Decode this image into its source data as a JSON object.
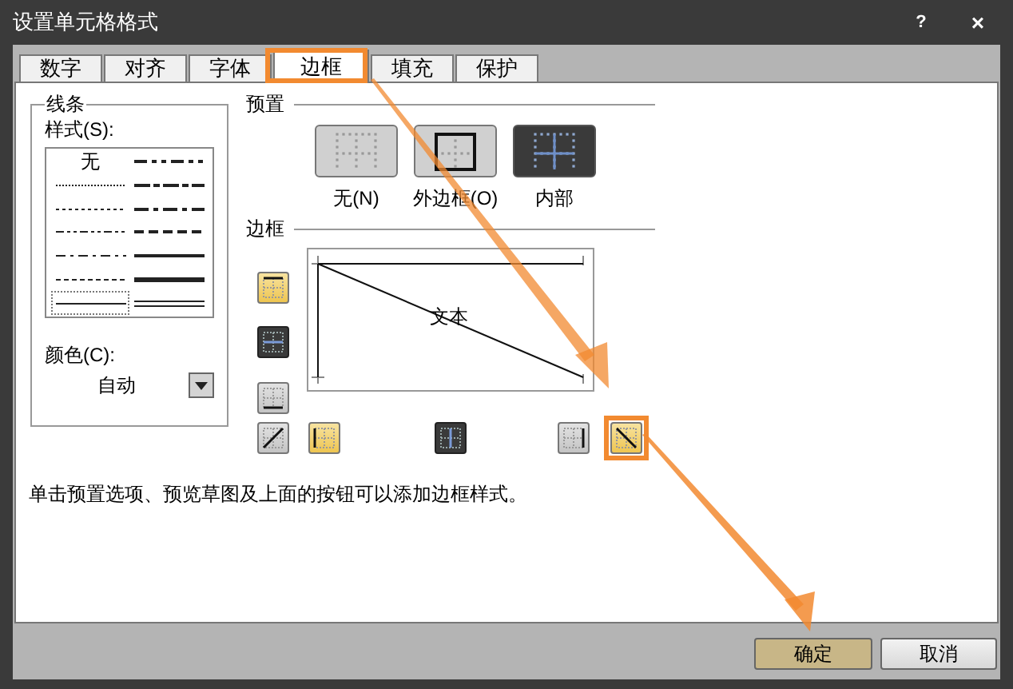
{
  "window": {
    "title": "设置单元格格式",
    "help": "?",
    "close": "×"
  },
  "tabs": [
    {
      "label": "数字",
      "selected": false
    },
    {
      "label": "对齐",
      "selected": false
    },
    {
      "label": "字体",
      "selected": false
    },
    {
      "label": "边框",
      "selected": true
    },
    {
      "label": "填充",
      "selected": false
    },
    {
      "label": "保护",
      "selected": false
    }
  ],
  "line": {
    "title": "线条",
    "style_label": "样式(S):",
    "styles": [
      {
        "kind": "none",
        "label": "无",
        "selected": false
      },
      {
        "kind": "medium-dash-dot-dot",
        "selected": false
      },
      {
        "kind": "hair",
        "selected": false
      },
      {
        "kind": "slanted-dash-dot",
        "selected": false
      },
      {
        "kind": "dotted",
        "selected": false
      },
      {
        "kind": "medium-dash-dot",
        "selected": false
      },
      {
        "kind": "dash-dot-dot",
        "selected": false
      },
      {
        "kind": "medium-dashed",
        "selected": false
      },
      {
        "kind": "dash-dot",
        "selected": false
      },
      {
        "kind": "medium",
        "selected": false
      },
      {
        "kind": "dashed",
        "selected": false
      },
      {
        "kind": "thick",
        "selected": false
      },
      {
        "kind": "thin",
        "selected": true
      },
      {
        "kind": "double",
        "selected": false
      }
    ],
    "color_label": "颜色(C):",
    "color_value": "自动"
  },
  "presets": {
    "title": "预置",
    "items": [
      {
        "kind": "none",
        "label": "无(N)",
        "selected": false
      },
      {
        "kind": "outline",
        "label": "外边框(O)",
        "selected": false
      },
      {
        "kind": "inside",
        "label": "内部",
        "selected": true
      }
    ]
  },
  "border": {
    "title": "边框",
    "preview_text": "文本",
    "side_buttons": [
      {
        "kind": "top",
        "highlighted": true,
        "pressed": false
      },
      {
        "kind": "inside-horizontal",
        "highlighted": false,
        "pressed": true
      },
      {
        "kind": "bottom",
        "highlighted": false,
        "pressed": false
      }
    ],
    "bottom_buttons": [
      {
        "kind": "diagonal-up",
        "highlighted": false,
        "pressed": false
      },
      {
        "kind": "left",
        "highlighted": true,
        "pressed": false
      },
      {
        "kind": "inside-vertical",
        "highlighted": false,
        "pressed": true
      },
      {
        "kind": "right",
        "highlighted": false,
        "pressed": false
      },
      {
        "kind": "diagonal-down",
        "highlighted": true,
        "pressed": false
      }
    ]
  },
  "hint": "单击预置选项、预览草图及上面的按钮可以添加边框样式。",
  "buttons": [
    {
      "label": "确定",
      "highlighted": true
    },
    {
      "label": "取消",
      "highlighted": false
    }
  ]
}
